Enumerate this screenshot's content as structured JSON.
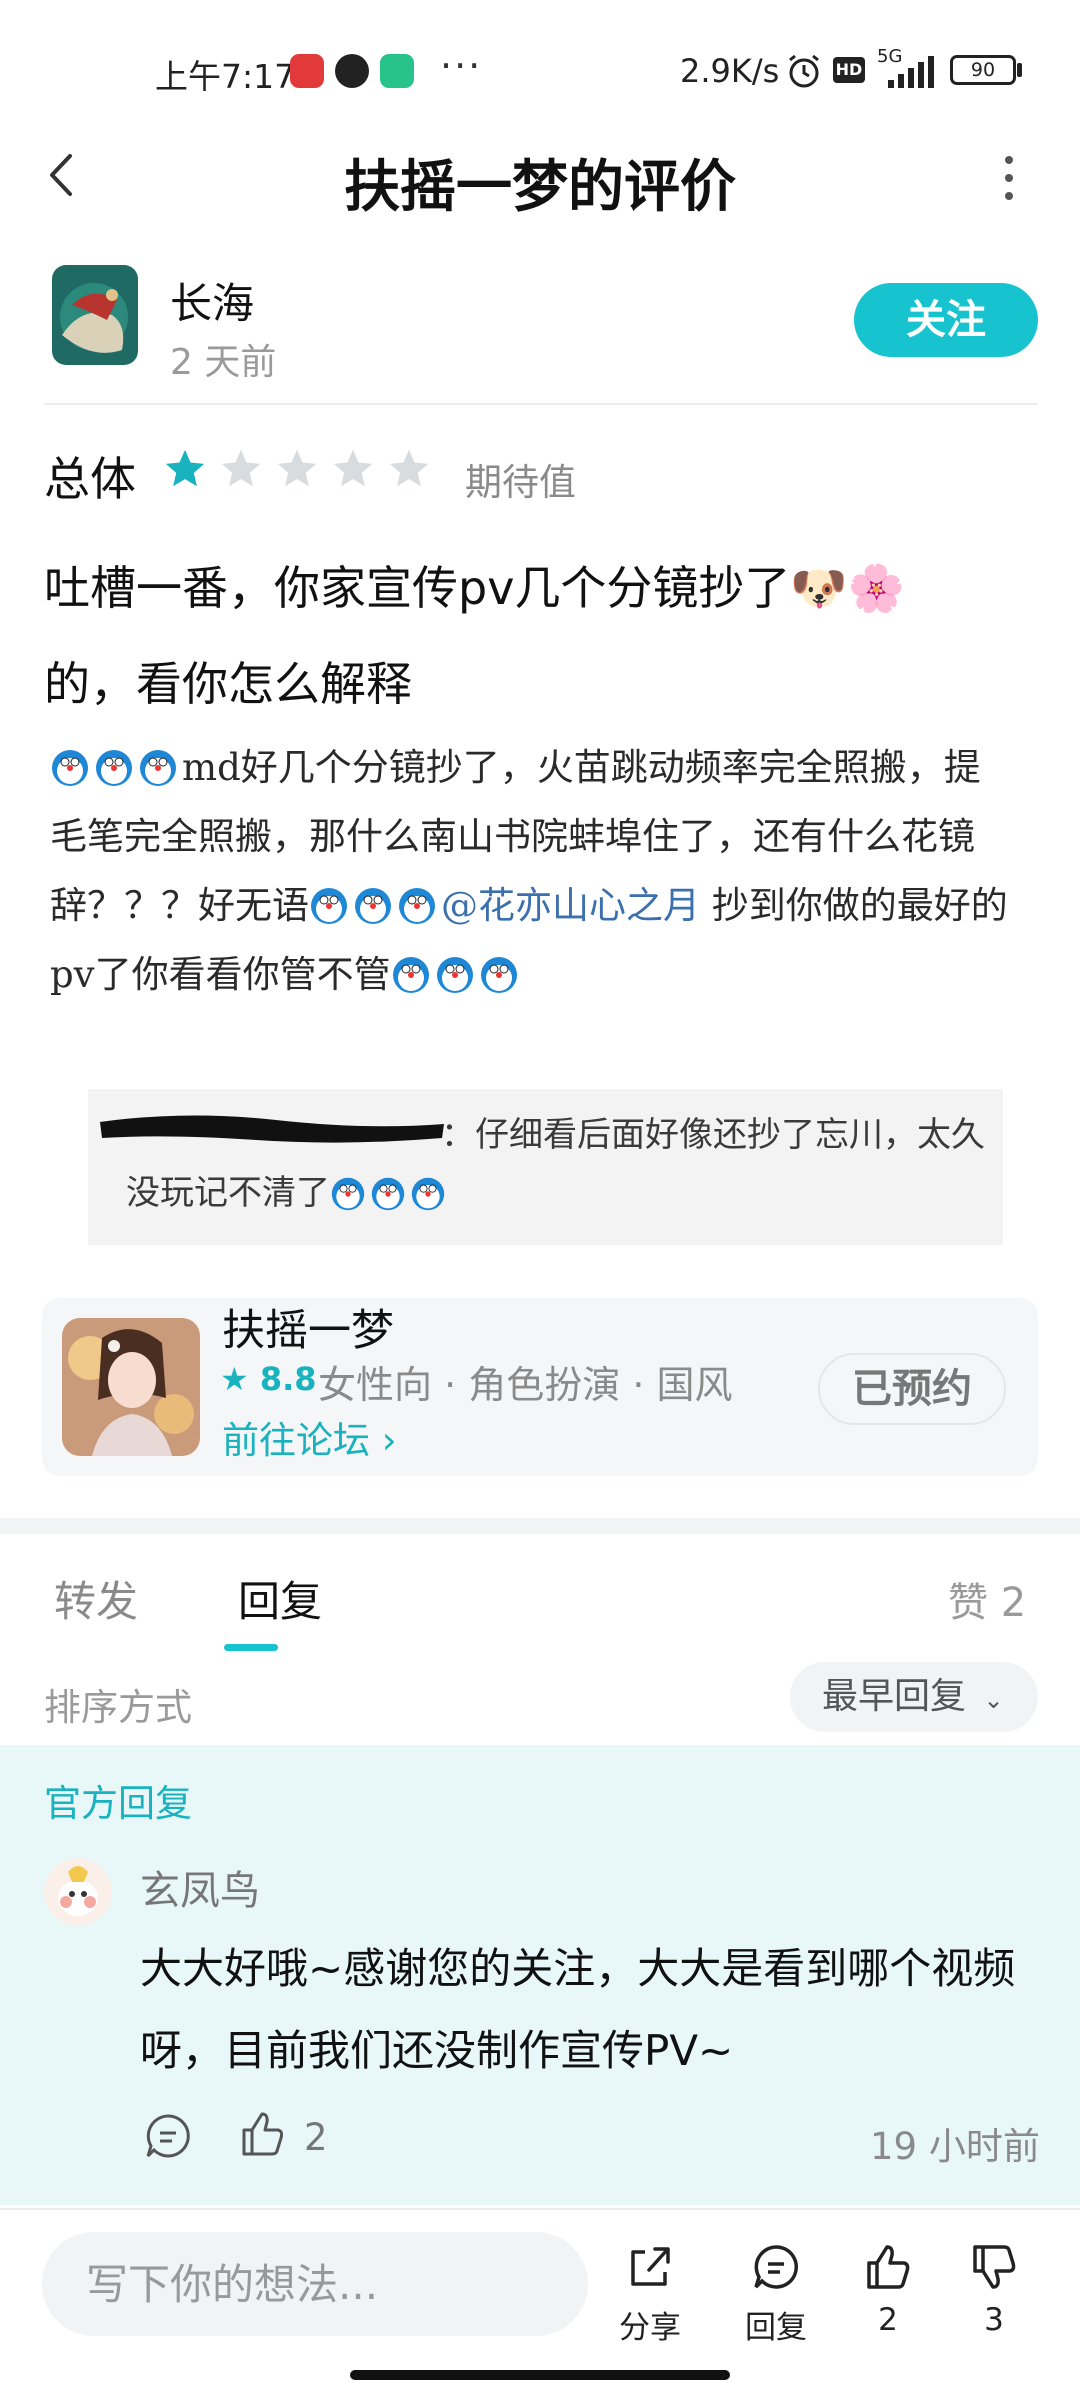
{
  "status_bar": {
    "time": "上午7:17",
    "network_speed": "2.9K/s",
    "signal": "5G",
    "battery": "90"
  },
  "header": {
    "title": "扶摇一梦的评价"
  },
  "author": {
    "name": "长海",
    "time": "2 天前",
    "follow_label": "关注"
  },
  "rating": {
    "label": "总体",
    "stars": 1,
    "max_stars": 5,
    "tag": "期待值"
  },
  "review": {
    "text_line1": "吐槽一番，你家宣传pv几个分镜抄了🐶🌸",
    "text_line2": "的，看你怎么解释"
  },
  "embedded_post": {
    "part1": "md好几个分镜抄了，火苗跳动频率完全照搬，提毛笔完全照搬，那什么南山书院蚌埠住了，还有什么花镜辞？？？好无语",
    "mention": "@花亦山心之月",
    "part2": " 抄到你做的最好的pv了你看看你管不管",
    "quote": "：仔细看后面好像还抄了忘川，太久没玩记不清了"
  },
  "game_card": {
    "name": "扶摇一梦",
    "rating": "8.8",
    "tags": "女性向 · 角色扮演 · 国风",
    "forum_link": "前往论坛 ›",
    "reserved_label": "已预约"
  },
  "tabs": {
    "repost": "转发",
    "reply": "回复",
    "likes": "赞 2"
  },
  "sort": {
    "label": "排序方式",
    "selected": "最早回复"
  },
  "official_reply": {
    "label": "官方回复",
    "name": "玄凤鸟",
    "text": "大大好哦~感谢您的关注，大大是看到哪个视频呀，目前我们还没制作宣传PV~",
    "likes": "2",
    "time": "19 小时前"
  },
  "bottom_bar": {
    "input_placeholder": "写下你的想法...",
    "share_label": "分享",
    "reply_label": "回复",
    "like_count": "2",
    "dislike_count": "3"
  },
  "colors": {
    "accent": "#17c3cf",
    "star_active": "#18b3be",
    "star_inactive": "#d9dcdf"
  }
}
